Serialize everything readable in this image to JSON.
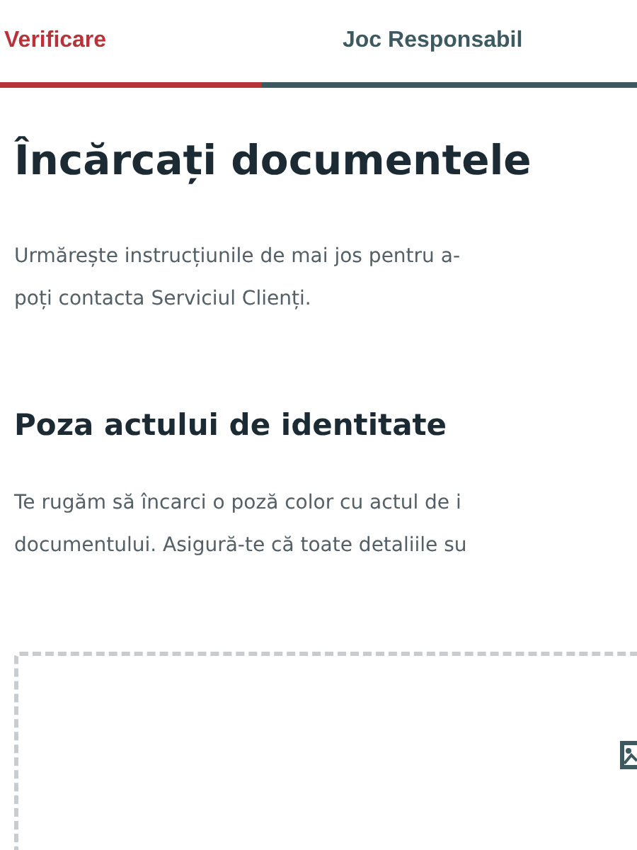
{
  "tabs": [
    {
      "label": "Verificare",
      "selected": true
    },
    {
      "label": "Joc Responsabil",
      "selected": false
    }
  ],
  "title": "Încărcați documentele",
  "intro_lines": [
    "Urmărește instrucțiunile de mai jos pentru a-",
    "poți contacta Serviciul Clienți."
  ],
  "section": {
    "title": "Poza actului de identitate",
    "lines": [
      "Te rugăm să încarci o poză color cu actul de i",
      "documentului. Asigură-te că toate detaliile su"
    ]
  }
}
